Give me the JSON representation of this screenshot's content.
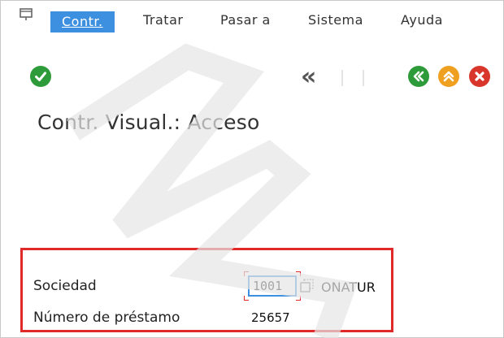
{
  "menu": {
    "items": [
      {
        "label": "Contr."
      },
      {
        "label": "Tratar"
      },
      {
        "label": "Pasar a"
      },
      {
        "label": "Sistema"
      },
      {
        "label": "Ayuda"
      }
    ]
  },
  "toolbar": {
    "icons": [
      "check-icon",
      "double-left-icon",
      "back-icon",
      "exit-icon",
      "cancel-icon"
    ]
  },
  "screen": {
    "title": "Contr. Visual.: Acceso"
  },
  "form": {
    "sociedad_label": "Sociedad",
    "sociedad_value": "1001",
    "sociedad_description": "ONATUR",
    "prestamo_label": "Número de préstamo",
    "prestamo_value": "25657"
  },
  "colors": {
    "menu_active": "#3d8fe0",
    "highlight_border": "#e02a2a",
    "ok_green": "#2e9b3a",
    "back_green": "#2e9b3a",
    "exit_orange": "#f0a020",
    "cancel_red": "#d9362b"
  }
}
